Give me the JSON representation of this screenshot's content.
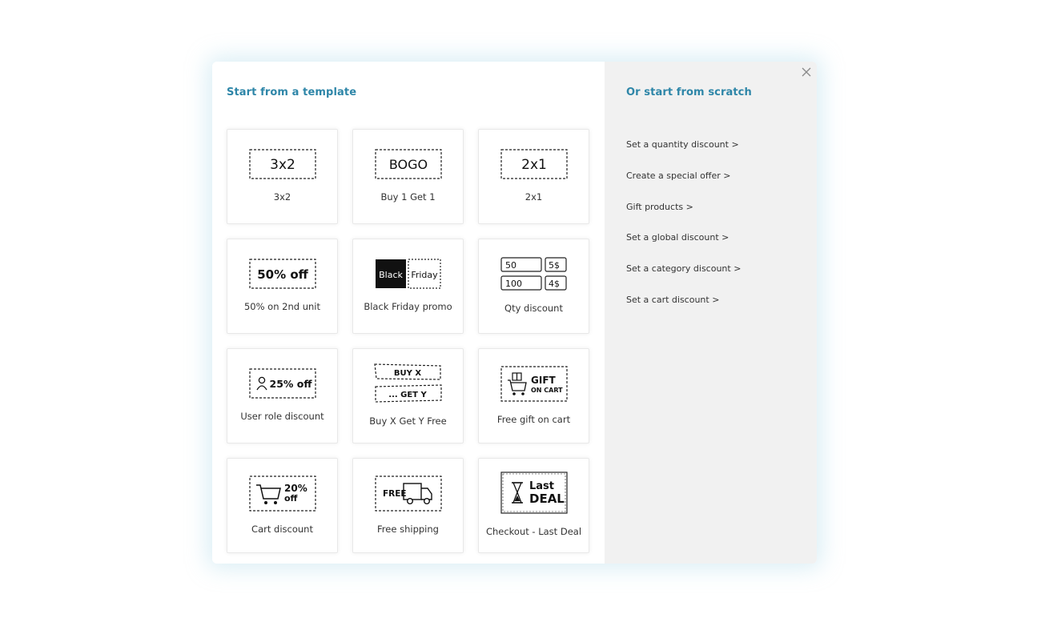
{
  "modal": {
    "left_title": "Start from a template",
    "right_title": "Or start from scratch"
  },
  "templates": [
    {
      "label": "3x2",
      "art_text": "3x2",
      "icon": "dashed-tag"
    },
    {
      "label": "Buy 1 Get 1",
      "art_text": "BOGO",
      "icon": "dashed-tag"
    },
    {
      "label": "2x1",
      "art_text": "2x1",
      "icon": "dashed-tag"
    },
    {
      "label": "50% on 2nd unit",
      "art_text": "50% off",
      "icon": "dashed-tag"
    },
    {
      "label": "Black Friday promo",
      "art_text_a": "Black",
      "art_text_b": "Friday",
      "icon": "black-friday-tag"
    },
    {
      "label": "Qty discount",
      "art_rows": [
        [
          "50",
          "5$"
        ],
        [
          "100",
          "4$"
        ]
      ],
      "icon": "qty-table"
    },
    {
      "label": "User role discount",
      "art_text": "25% off",
      "icon": "user-icon"
    },
    {
      "label": "Buy X Get Y Free",
      "art_text_a": "BUY X",
      "art_text_b": "... GET Y",
      "icon": "double-ticket"
    },
    {
      "label": "Free gift on cart",
      "art_text_a": "GIFT",
      "art_text_b": "ON CART",
      "icon": "gift-cart-icon"
    },
    {
      "label": "Cart discount",
      "art_text_a": "20%",
      "art_text_b": "off",
      "icon": "cart-icon"
    },
    {
      "label": "Free shipping",
      "art_text": "FREE",
      "icon": "truck-icon"
    },
    {
      "label": "Checkout - Last Deal",
      "art_text_a": "Last",
      "art_text_b": "DEAL",
      "icon": "hourglass-icon"
    }
  ],
  "scratch_links": [
    "Set a quantity discount >",
    "Create a special offer >",
    "Gift products >",
    "Set a global discount >",
    "Set a category discount >",
    "Set a cart discount >"
  ],
  "colors": {
    "accent": "#2e86a8",
    "right_pane_bg": "#f1f1f1"
  }
}
